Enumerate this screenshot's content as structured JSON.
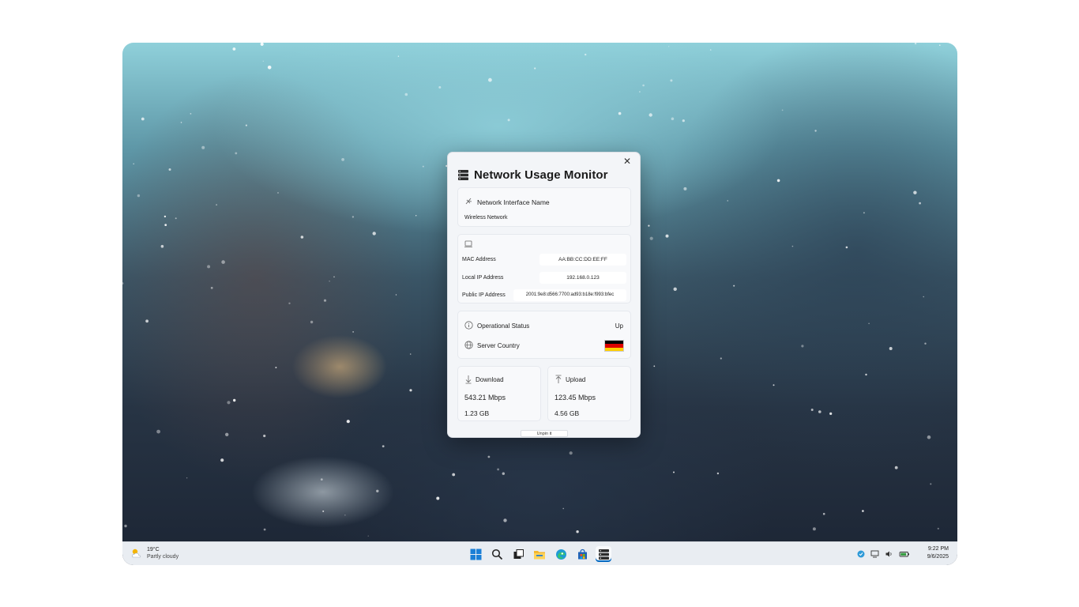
{
  "widget": {
    "title": "Network Usage Monitor",
    "close_glyph": "✕",
    "interface": {
      "label": "Network Interface Name",
      "value": "Wireless Network"
    },
    "addresses": {
      "mac_label": "MAC Address",
      "mac_value": "AA:BB:CC:DD:EE:FF",
      "local_label": "Local IP Address",
      "local_value": "192.168.0.123",
      "public_label": "Public IP Address",
      "public_value": "2001:9e8:d566:7700:ad93:b18e:f993:bfec"
    },
    "status": {
      "operational_label": "Operational Status",
      "operational_value": "Up",
      "country_label": "Server Country",
      "flag_colors": [
        "#000000",
        "#dd0000",
        "#ffce00"
      ]
    },
    "download": {
      "label": "Download",
      "rate": "543.21 Mbps",
      "total": "1.23 GB"
    },
    "upload": {
      "label": "Upload",
      "rate": "123.45 Mbps",
      "total": "4.56 GB"
    },
    "unpin_label": "Unpin it"
  },
  "taskbar": {
    "weather_temp": "19°C",
    "weather_desc": "Partly cloudy",
    "time": "9:22 PM",
    "date": "9/6/2025",
    "apps": [
      "start-icon",
      "search-icon",
      "task-view-icon",
      "file-explorer-icon",
      "edge-icon",
      "store-icon",
      "network-monitor-icon"
    ]
  },
  "colors": {
    "accent": "#0067c0",
    "widget_bg": "#f3f5f8"
  }
}
